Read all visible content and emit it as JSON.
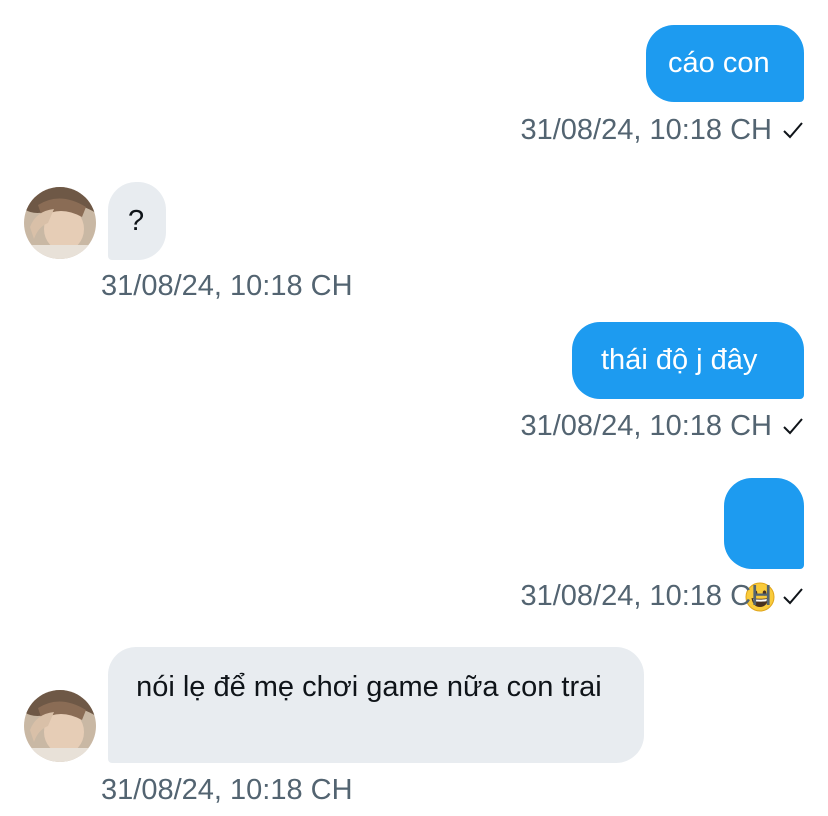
{
  "conversation": {
    "messages": [
      {
        "direction": "outgoing",
        "text": "cáo con",
        "timestamp": "31/08/24, 10:18 CH",
        "status_icon": "check-icon"
      },
      {
        "direction": "incoming",
        "text": "?",
        "timestamp": "31/08/24, 10:18 CH",
        "avatar_icon": "user-avatar"
      },
      {
        "direction": "outgoing",
        "text": "thái độ j đây",
        "timestamp": "31/08/24, 10:18 CH",
        "status_icon": "check-icon"
      },
      {
        "direction": "outgoing",
        "text": "",
        "emoji": "grinning-face-emoji",
        "timestamp": "31/08/24, 10:18 CH",
        "status_icon": "check-icon"
      },
      {
        "direction": "incoming",
        "text": " nói lẹ để mẹ chơi game nữa con trai",
        "timestamp": "31/08/24, 10:18 CH",
        "avatar_icon": "user-avatar"
      }
    ]
  },
  "colors": {
    "outgoing_bubble": "#1d9bf0",
    "incoming_bubble": "#e8ecf0",
    "timestamp_text": "#536471"
  }
}
